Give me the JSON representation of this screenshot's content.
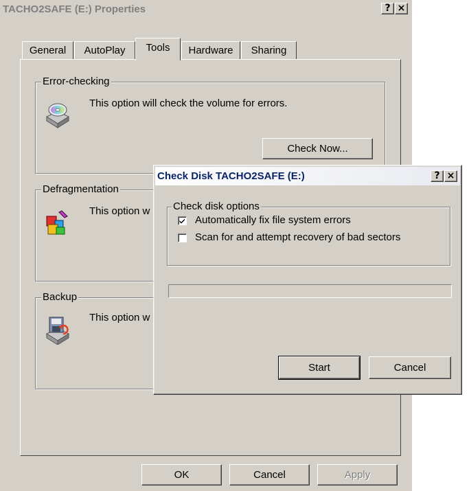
{
  "properties": {
    "title": "TACHO2SAFE (E:) Properties",
    "help_btn": "?",
    "close_btn": "×",
    "tabs": [
      "General",
      "AutoPlay",
      "Tools",
      "Hardware",
      "Sharing"
    ],
    "active_tab": "Tools",
    "error_group": {
      "label": "Error-checking",
      "text": "This option will check the volume for errors.",
      "button": "Check Now..."
    },
    "defrag_group": {
      "label": "Defragmentation",
      "text": "This option w"
    },
    "backup_group": {
      "label": "Backup",
      "text": "This option w"
    },
    "ok": "OK",
    "cancel": "Cancel",
    "apply": "Apply"
  },
  "checkdisk": {
    "title": "Check Disk TACHO2SAFE (E:)",
    "help_btn": "?",
    "close_btn": "×",
    "options_label": "Check disk options",
    "option1": {
      "label": "Automatically fix file system errors",
      "checked": true
    },
    "option2": {
      "label": "Scan for and attempt recovery of bad sectors",
      "checked": false
    },
    "progress": 0,
    "start": "Start",
    "cancel": "Cancel"
  }
}
